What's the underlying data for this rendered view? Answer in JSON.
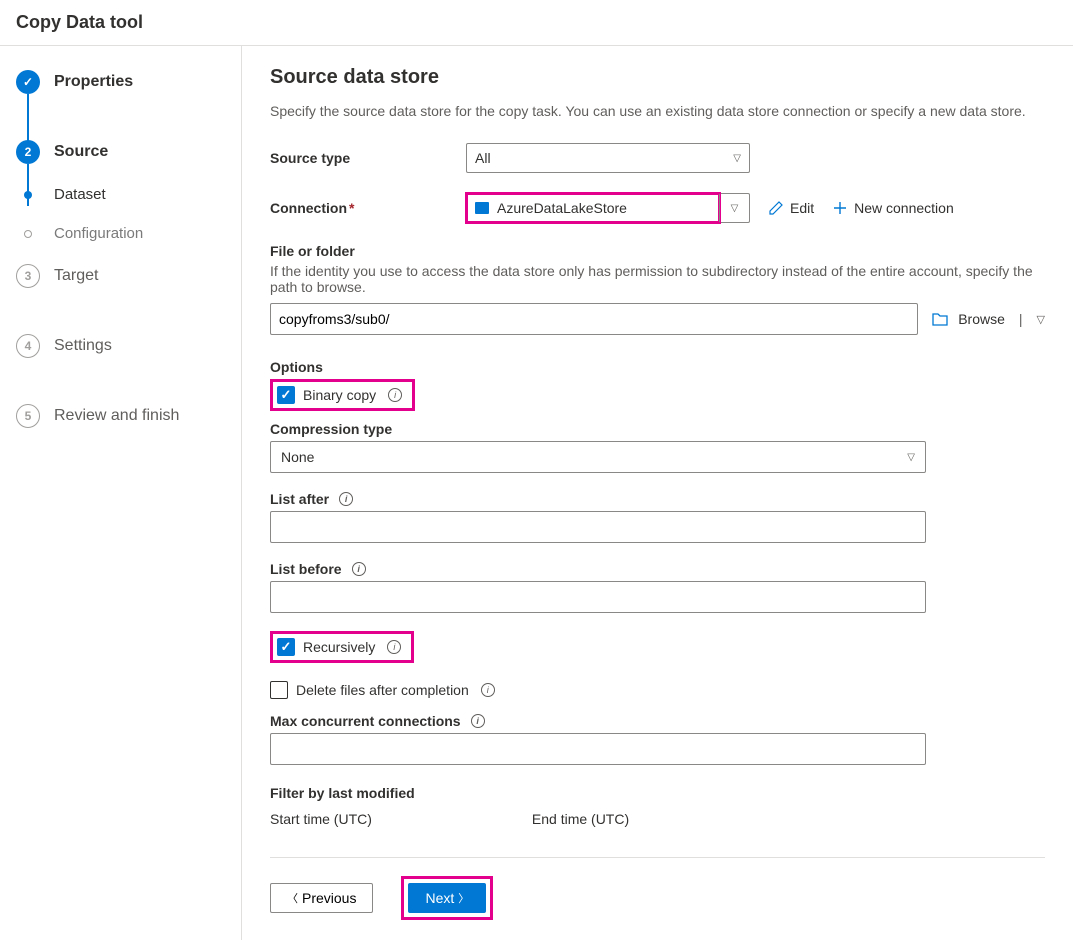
{
  "header": {
    "title": "Copy Data tool"
  },
  "sidebar": {
    "steps": [
      {
        "label": "Properties"
      },
      {
        "label": "Source"
      },
      {
        "label": "Dataset"
      },
      {
        "label": "Configuration"
      },
      {
        "label": "Target"
      },
      {
        "label": "Settings"
      },
      {
        "label": "Review and finish"
      }
    ]
  },
  "main": {
    "title": "Source data store",
    "subtitle": "Specify the source data store for the copy task. You can use an existing data store connection or specify a new data store.",
    "sourceTypeLabel": "Source type",
    "sourceTypeValue": "All",
    "connectionLabel": "Connection",
    "connectionValue": "AzureDataLakeStore",
    "editLabel": "Edit",
    "newConnLabel": "New connection",
    "fileFolderLabel": "File or folder",
    "fileFolderHelp": "If the identity you use to access the data store only has permission to subdirectory instead of the entire account, specify the path to browse.",
    "fileFolderValue": "copyfroms3/sub0/",
    "browseLabel": "Browse",
    "optionsLabel": "Options",
    "binaryCopyLabel": "Binary copy",
    "compressionTypeLabel": "Compression type",
    "compressionTypeValue": "None",
    "listAfterLabel": "List after",
    "listBeforeLabel": "List before",
    "recursivelyLabel": "Recursively",
    "deleteFilesLabel": "Delete files after completion",
    "maxConnLabel": "Max concurrent connections",
    "filterLabel": "Filter by last modified",
    "startTimeLabel": "Start time (UTC)",
    "endTimeLabel": "End time (UTC)"
  },
  "footer": {
    "previousLabel": "Previous",
    "nextLabel": "Next"
  }
}
